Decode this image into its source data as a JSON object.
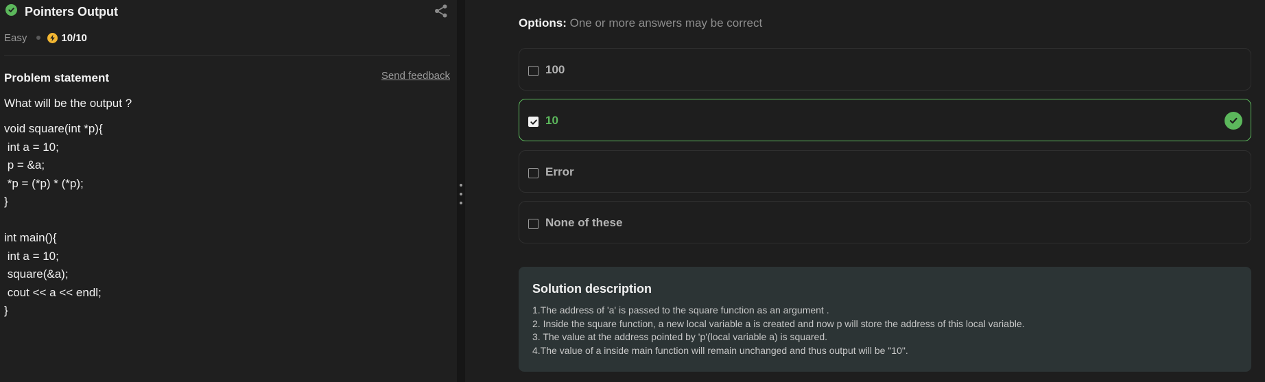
{
  "problem": {
    "title": "Pointers Output",
    "difficulty": "Easy",
    "score": "10/10",
    "statement_heading": "Problem statement",
    "feedback_link": "Send feedback",
    "question": "What will be the output ?",
    "code": "void square(int *p){\n int a = 10;\n p = &a;\n *p = (*p) * (*p);\n}\n\nint main(){\n int a = 10;\n square(&a);\n cout << a << endl;\n}"
  },
  "options_panel": {
    "heading_bold": "Options:",
    "heading_sub": "One or more answers may be correct",
    "options": [
      {
        "label": "100",
        "selected": false,
        "correct": false
      },
      {
        "label": "10",
        "selected": true,
        "correct": true
      },
      {
        "label": "Error",
        "selected": false,
        "correct": false
      },
      {
        "label": "None of these",
        "selected": false,
        "correct": false
      }
    ]
  },
  "solution": {
    "title": "Solution description",
    "lines": [
      "1.The address of 'a' is passed to the square function as an argument .",
      "2. Inside the square function, a new local variable a is created and now p will store the address of this local variable.",
      "3. The value at the address pointed by 'p'(local variable a) is squared.",
      "4.The value of a inside main function will remain unchanged and thus output will be \"10\"."
    ]
  },
  "colors": {
    "accent_green": "#5cb85c",
    "score_icon": "#f2b632",
    "solution_bg": "#2c3435"
  },
  "icons": {
    "status": "check-circle-icon",
    "share": "share-icon",
    "score": "bolt-icon",
    "correct": "check-circle-icon"
  }
}
